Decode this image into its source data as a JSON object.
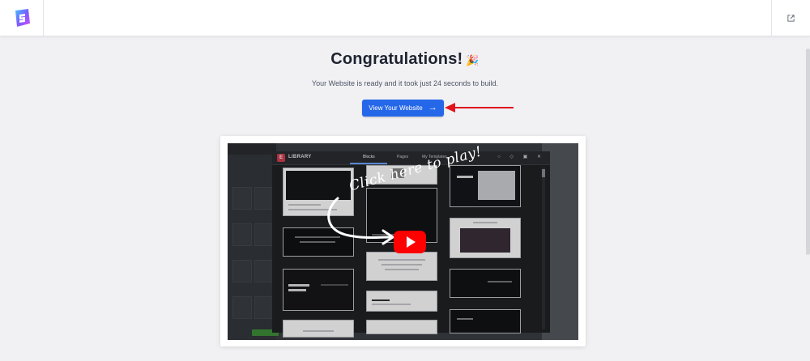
{
  "header": {
    "logo_icon": "brand-logo-icon",
    "external_link_icon": "external-link-icon"
  },
  "main": {
    "title": "Congratulations!",
    "title_emoji": "🎉",
    "subtitle": "Your Website is ready and it took just 24 seconds to build.",
    "cta_label": "View Your Website",
    "cta_icon": "→"
  },
  "video": {
    "overlay_text": "Click here to play!",
    "library": {
      "title": "LIBRARY",
      "tabs": [
        "Blocks",
        "Pages",
        "My Templates"
      ],
      "active_tab": "Blocks"
    }
  },
  "colors": {
    "primary": "#2567e9",
    "annotation_arrow": "#e0141b",
    "play_button": "#ff0000",
    "background": "#f1f1f4"
  }
}
